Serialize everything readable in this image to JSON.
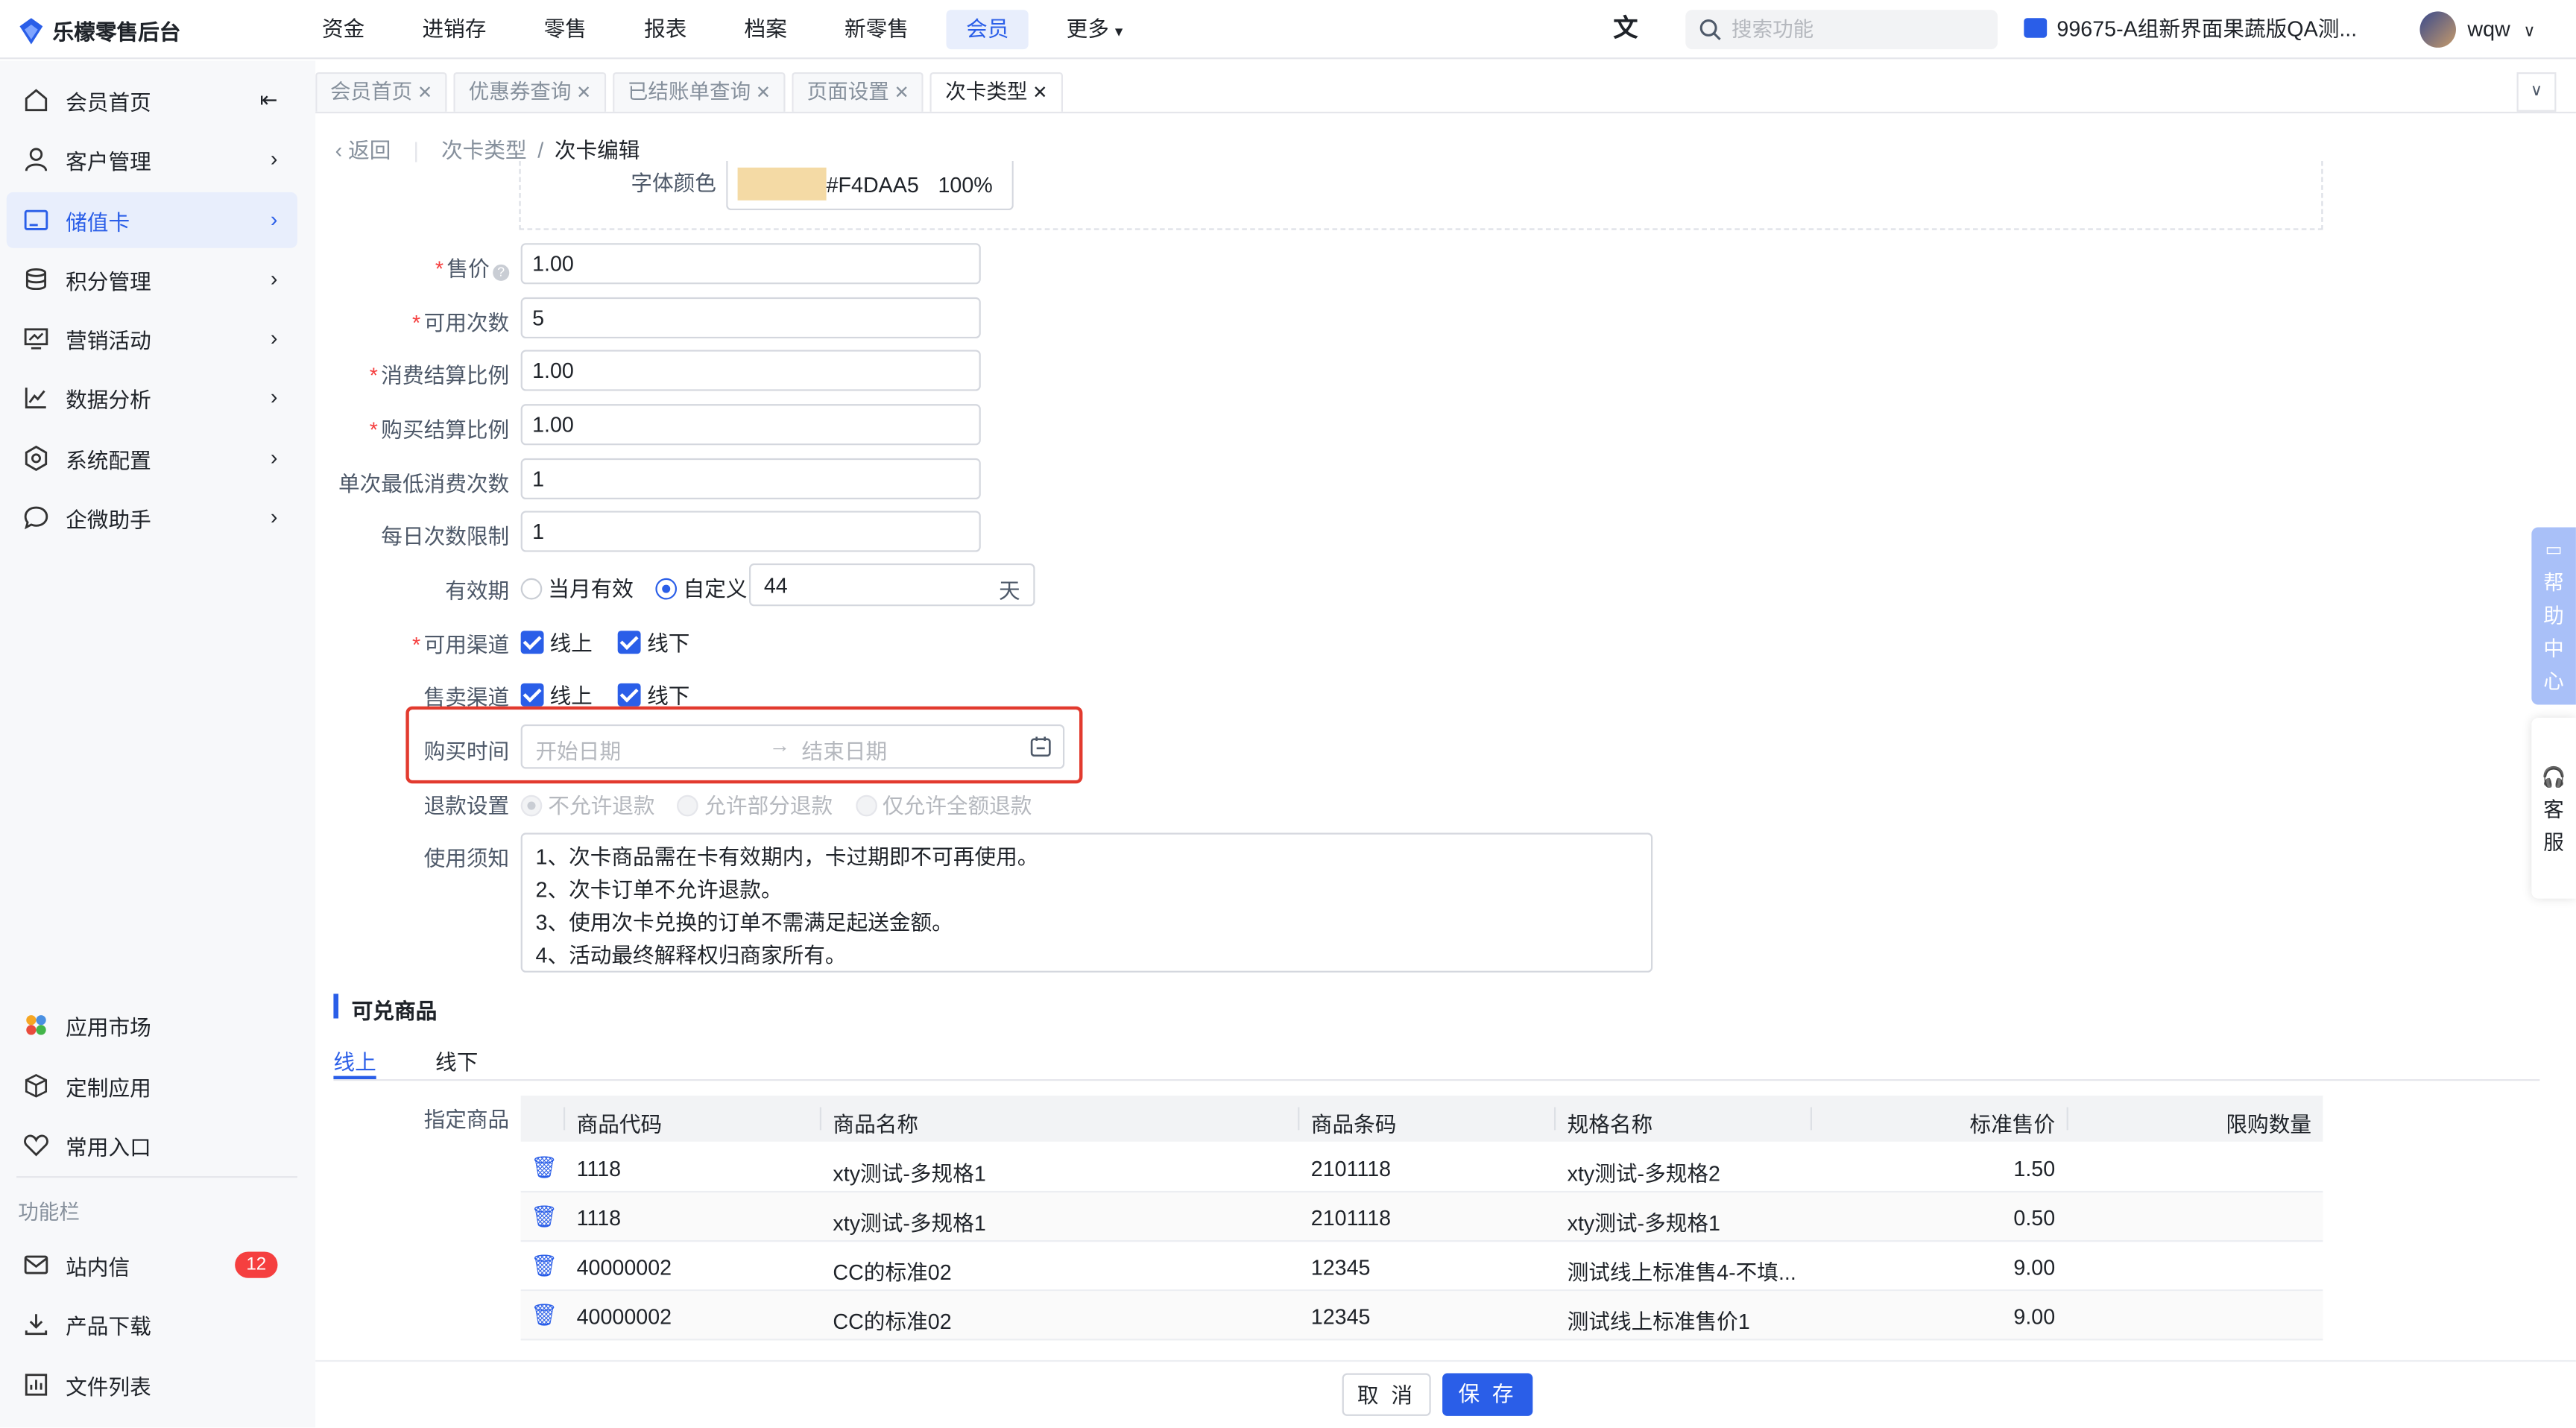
{
  "app": {
    "title": "乐檬零售后台"
  },
  "nav": {
    "items": [
      "资金",
      "进销存",
      "零售",
      "报表",
      "档案",
      "新零售",
      "会员",
      "更多"
    ],
    "active": "会员"
  },
  "topbar": {
    "search_placeholder": "搜索功能",
    "store": "99675-A组新界面果蔬版QA测...",
    "user": "wqw"
  },
  "sidebar": {
    "items": [
      {
        "label": "会员首页",
        "icon": "home-icon"
      },
      {
        "label": "客户管理",
        "icon": "user-icon"
      },
      {
        "label": "储值卡",
        "icon": "card-icon",
        "active": true
      },
      {
        "label": "积分管理",
        "icon": "database-icon"
      },
      {
        "label": "营销活动",
        "icon": "monitor-icon"
      },
      {
        "label": "数据分析",
        "icon": "chart-line-icon"
      },
      {
        "label": "系统配置",
        "icon": "gear-icon"
      },
      {
        "label": "企微助手",
        "icon": "chat-icon"
      }
    ],
    "bottom": [
      {
        "label": "应用市场",
        "icon": "apps-icon"
      },
      {
        "label": "定制应用",
        "icon": "cube-icon"
      },
      {
        "label": "常用入口",
        "icon": "heart-icon"
      }
    ],
    "section": "功能栏",
    "func": [
      {
        "label": "站内信",
        "icon": "mail-icon",
        "badge": "12"
      },
      {
        "label": "产品下载",
        "icon": "download-icon"
      },
      {
        "label": "文件列表",
        "icon": "file-chart-icon"
      }
    ]
  },
  "tabs": [
    "会员首页",
    "优惠券查询",
    "已结账单查询",
    "页面设置",
    "次卡类型"
  ],
  "breadcrumb": {
    "back": "返回",
    "parent": "次卡类型",
    "sep": "/",
    "current": "次卡编辑"
  },
  "form": {
    "font_color": {
      "label": "字体颜色",
      "hex": "#F4DAA5",
      "opacity": "100%"
    },
    "price": {
      "label": "售价",
      "value": "1.00"
    },
    "times": {
      "label": "可用次数",
      "value": "5"
    },
    "consume_ratio": {
      "label": "消费结算比例",
      "value": "1.00"
    },
    "buy_ratio": {
      "label": "购买结算比例",
      "value": "1.00"
    },
    "min_times": {
      "label": "单次最低消费次数",
      "value": "1"
    },
    "daily_limit": {
      "label": "每日次数限制",
      "value": "1"
    },
    "validity": {
      "label": "有效期",
      "opt1": "当月有效",
      "opt2": "自定义",
      "days": "44",
      "unit": "天"
    },
    "channel": {
      "label": "可用渠道",
      "online": "线上",
      "offline": "线下"
    },
    "sale_channel": {
      "label": "售卖渠道",
      "online": "线上",
      "offline": "线下"
    },
    "purchase_time": {
      "label": "购买时间",
      "start": "开始日期",
      "end": "结束日期"
    },
    "refund": {
      "label": "退款设置",
      "opt1": "不允许退款",
      "opt2": "允许部分退款",
      "opt3": "仅允许全额退款"
    },
    "notice": {
      "label": "使用须知",
      "lines": [
        "1、次卡商品需在卡有效期内，卡过期即不可再使用。",
        "2、次卡订单不允许退款。",
        "3、使用次卡兑换的订单不需满足起送金额。",
        "4、活动最终解释权归商家所有。"
      ]
    }
  },
  "goods": {
    "title": "可兑商品",
    "tabs": [
      "线上",
      "线下"
    ],
    "label": "指定商品",
    "columns": [
      "商品代码",
      "商品名称",
      "商品条码",
      "规格名称",
      "标准售价",
      "限购数量"
    ],
    "rows": [
      [
        "1118",
        "xty测试-多规格1",
        "2101118",
        "xty测试-多规格2",
        "1.50",
        ""
      ],
      [
        "1118",
        "xty测试-多规格1",
        "2101118",
        "xty测试-多规格1",
        "0.50",
        ""
      ],
      [
        "40000002",
        "CC的标准02",
        "12345",
        "测试线上标准售4-不填...",
        "9.00",
        ""
      ],
      [
        "40000002",
        "CC的标准02",
        "12345",
        "测试线上标准售价1",
        "9.00",
        ""
      ]
    ]
  },
  "footer": {
    "cancel": "取 消",
    "save": "保 存"
  },
  "float": {
    "help": [
      "帮",
      "助",
      "中",
      "心"
    ],
    "service": [
      "客",
      "服"
    ]
  },
  "colors": {
    "accent": "#2A5EE8",
    "highlight": "#E23A2E",
    "swatch": "#F4DAA5"
  }
}
